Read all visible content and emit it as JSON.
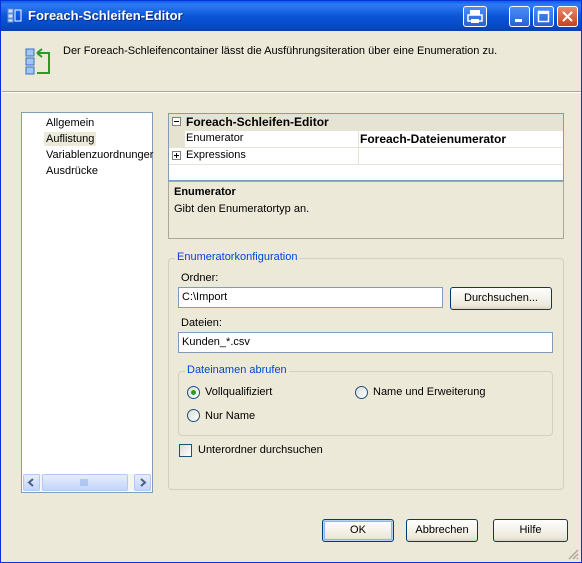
{
  "window": {
    "title": "Foreach-Schleifen-Editor",
    "controls": [
      "help",
      "minimize",
      "maximize",
      "close"
    ]
  },
  "header": {
    "description": "Der Foreach-Schleifencontainer lässt die Ausführungsiteration über eine Enumeration zu."
  },
  "nav": {
    "items": [
      {
        "label": "Allgemein",
        "selected": false
      },
      {
        "label": "Auflistung",
        "selected": true
      },
      {
        "label": "Variablenzuordnunger",
        "selected": false
      },
      {
        "label": "Ausdrücke",
        "selected": false
      }
    ]
  },
  "property_grid": {
    "category": "Foreach-Schleifen-Editor",
    "rows": [
      {
        "name": "Enumerator",
        "value": "Foreach-Dateienumerator"
      },
      {
        "name": "Expressions",
        "value": ""
      }
    ]
  },
  "description_box": {
    "title": "Enumerator",
    "text": "Gibt den Enumeratortyp an."
  },
  "enum_config": {
    "legend": "Enumeratorkonfiguration",
    "folder_label": "Ordner:",
    "folder_value": "C:\\Import",
    "browse_button": "Durchsuchen...",
    "files_label": "Dateien:",
    "files_value": "Kunden_*.csv",
    "retrieve_legend": "Dateinamen abrufen",
    "radio_full": "Vollqualifiziert",
    "radio_name_ext": "Name und Erweiterung",
    "radio_name_only": "Nur Name",
    "selected_radio": "Vollqualifiziert",
    "subfolders_label": "Unterordner durchsuchen",
    "subfolders_checked": false
  },
  "footer": {
    "ok": "OK",
    "cancel": "Abbrechen",
    "help": "Hilfe"
  }
}
